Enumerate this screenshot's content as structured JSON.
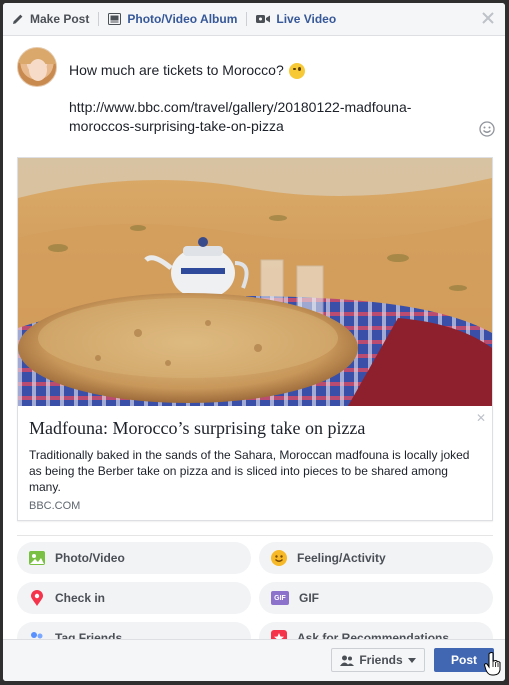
{
  "tabs": {
    "make_post": "Make Post",
    "photo_album": "Photo/Video Album",
    "live_video": "Live Video"
  },
  "status": {
    "line1": "How much are tickets to Morocco?",
    "url_line1": "http://www.bbc.com/travel/gallery/20180122-madfouna-",
    "url_line2": "moroccos-surprising-take-on-pizza"
  },
  "preview": {
    "title": "Madfouna: Morocco’s surprising take on pizza",
    "description": "Traditionally baked in the sands of the Sahara, Moroccan madfouna is locally joked as being the Berber take on pizza and is sliced into pieces to be shared among many.",
    "domain": "BBC.COM",
    "close_glyph": "✕"
  },
  "options": {
    "photo_video": "Photo/Video",
    "feeling": "Feeling/Activity",
    "check_in": "Check in",
    "gif": "GIF",
    "gif_badge": "GIF",
    "tag_friends": "Tag Friends",
    "ask_recs": "Ask for Recommendations"
  },
  "footer": {
    "audience": "Friends",
    "post": "Post"
  },
  "colors": {
    "brand_blue": "#4267b2",
    "link_blue": "#365899",
    "photo_green": "#7ac143",
    "feeling_yellow": "#f7b928",
    "checkin_pink": "#f5334b",
    "gif_purple": "#8c72cb"
  },
  "icons": {
    "pencil": "pencil-icon",
    "album": "album-icon",
    "video": "video-camera-icon",
    "close": "close-icon",
    "emoji": "emoji-icon",
    "photo": "photo-icon",
    "feeling": "smiley-icon",
    "checkin": "map-pin-icon",
    "gif": "gif-icon",
    "tag": "tag-friends-icon",
    "ask": "recommendation-icon",
    "friends": "friends-icon",
    "cursor": "hand-cursor-icon"
  }
}
